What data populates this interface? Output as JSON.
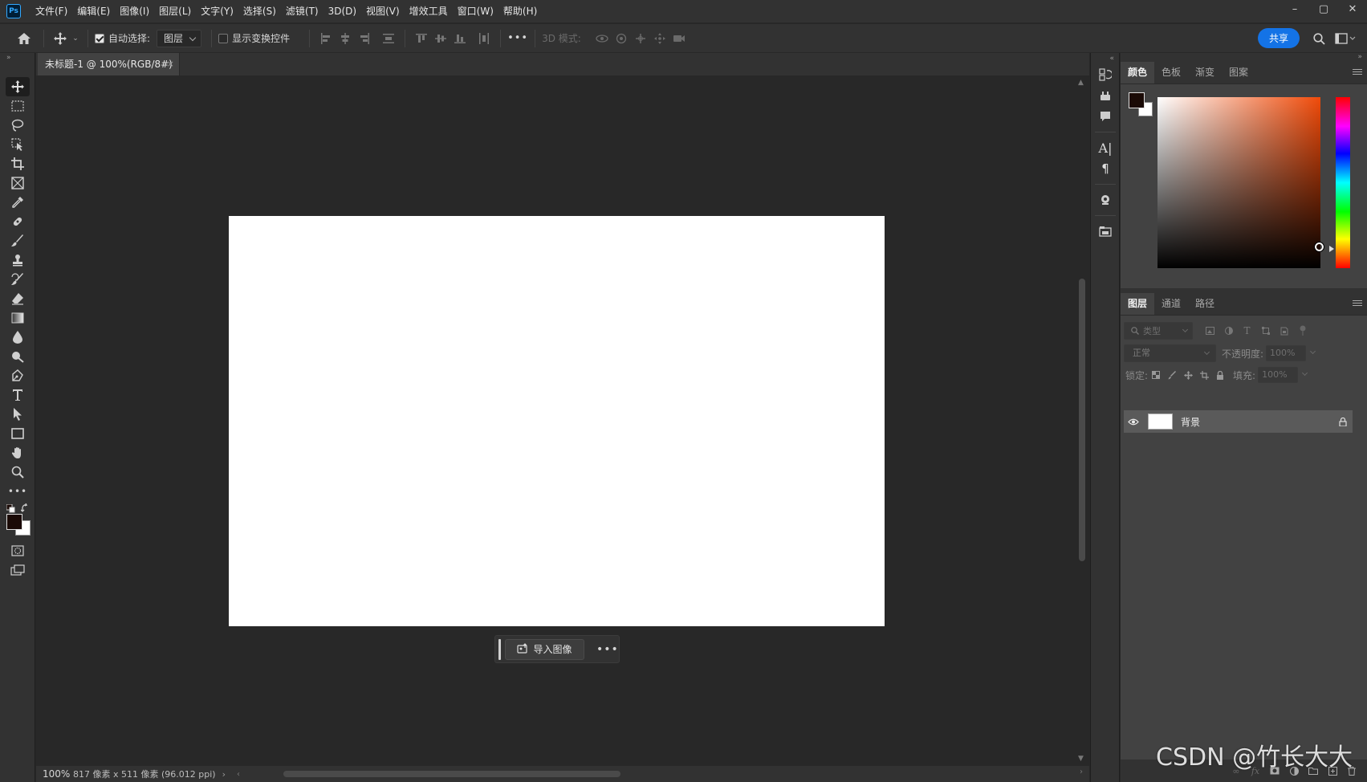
{
  "app": {
    "logo_text": "Ps",
    "menus": [
      "文件(F)",
      "编辑(E)",
      "图像(I)",
      "图层(L)",
      "文字(Y)",
      "选择(S)",
      "滤镜(T)",
      "3D(D)",
      "视图(V)",
      "增效工具",
      "窗口(W)",
      "帮助(H)"
    ],
    "window_controls": {
      "minimize": "–",
      "maximize": "▢",
      "close": "✕"
    }
  },
  "options_bar": {
    "auto_select_label": "自动选择:",
    "auto_select_checked": true,
    "auto_select_target": "图层",
    "show_transform_label": "显示变换控件",
    "show_transform_checked": false,
    "more": "•••",
    "mode_3d_label": "3D 模式:",
    "share_label": "共享"
  },
  "toolbar": {
    "collapse": "»",
    "tools": [
      "move",
      "marquee",
      "lasso",
      "object-select",
      "crop",
      "frame",
      "eyedropper",
      "healing",
      "brush",
      "stamp",
      "history-brush",
      "eraser",
      "gradient",
      "blur",
      "dodge",
      "pen",
      "type",
      "path-select",
      "rectangle",
      "hand",
      "zoom",
      "more"
    ],
    "foreground_color": "#1a0a06",
    "background_color": "#ffffff"
  },
  "document": {
    "tab_title": "未标题-1 @ 100%(RGB/8#)",
    "tab_close": "×",
    "zoom": "100%",
    "info": "817 像素 x 511 像素 (96.012 ppi)",
    "status_arrow": "›",
    "canvas_color": "#ffffff",
    "import_label": "导入图像",
    "more": "•••"
  },
  "color_panel": {
    "tabs": [
      "颜色",
      "色板",
      "渐变",
      "图案"
    ],
    "active_tab": "颜色",
    "hue_color": "#f04b0a",
    "foreground": "#1a0a06",
    "background": "#ffffff"
  },
  "layers_panel": {
    "tabs": [
      "图层",
      "通道",
      "路径"
    ],
    "active_tab": "图层",
    "filter_placeholder": "类型",
    "blend_mode": "正常",
    "opacity_label": "不透明度:",
    "opacity_value": "100%",
    "lock_label": "锁定:",
    "fill_label": "填充:",
    "fill_value": "100%",
    "layers": [
      {
        "name": "背景",
        "visible": true,
        "locked": true
      }
    ]
  },
  "watermark": "CSDN @竹长大大"
}
